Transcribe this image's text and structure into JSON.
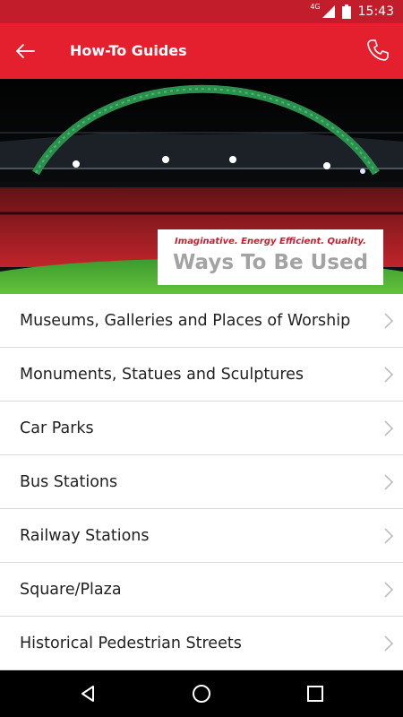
{
  "status_bar": {
    "network": "4G",
    "time": "15:43"
  },
  "app_bar": {
    "title": "How-To Guides",
    "back_icon": "arrow-left-icon",
    "action_icon": "phone-icon"
  },
  "hero": {
    "tagline": "Imaginative. Energy Efficient. Quality.",
    "title": "Ways To Be Used"
  },
  "list": {
    "items": [
      {
        "label": "Museums, Galleries and Places of Worship"
      },
      {
        "label": "Monuments, Statues and Sculptures"
      },
      {
        "label": "Car Parks"
      },
      {
        "label": "Bus Stations"
      },
      {
        "label": "Railway Stations"
      },
      {
        "label": "Square/Plaza"
      },
      {
        "label": "Historical Pedestrian Streets"
      }
    ]
  },
  "colors": {
    "primary": "#e41f2e",
    "status_bar": "#c21d2b",
    "tagline": "#d11a2a"
  }
}
